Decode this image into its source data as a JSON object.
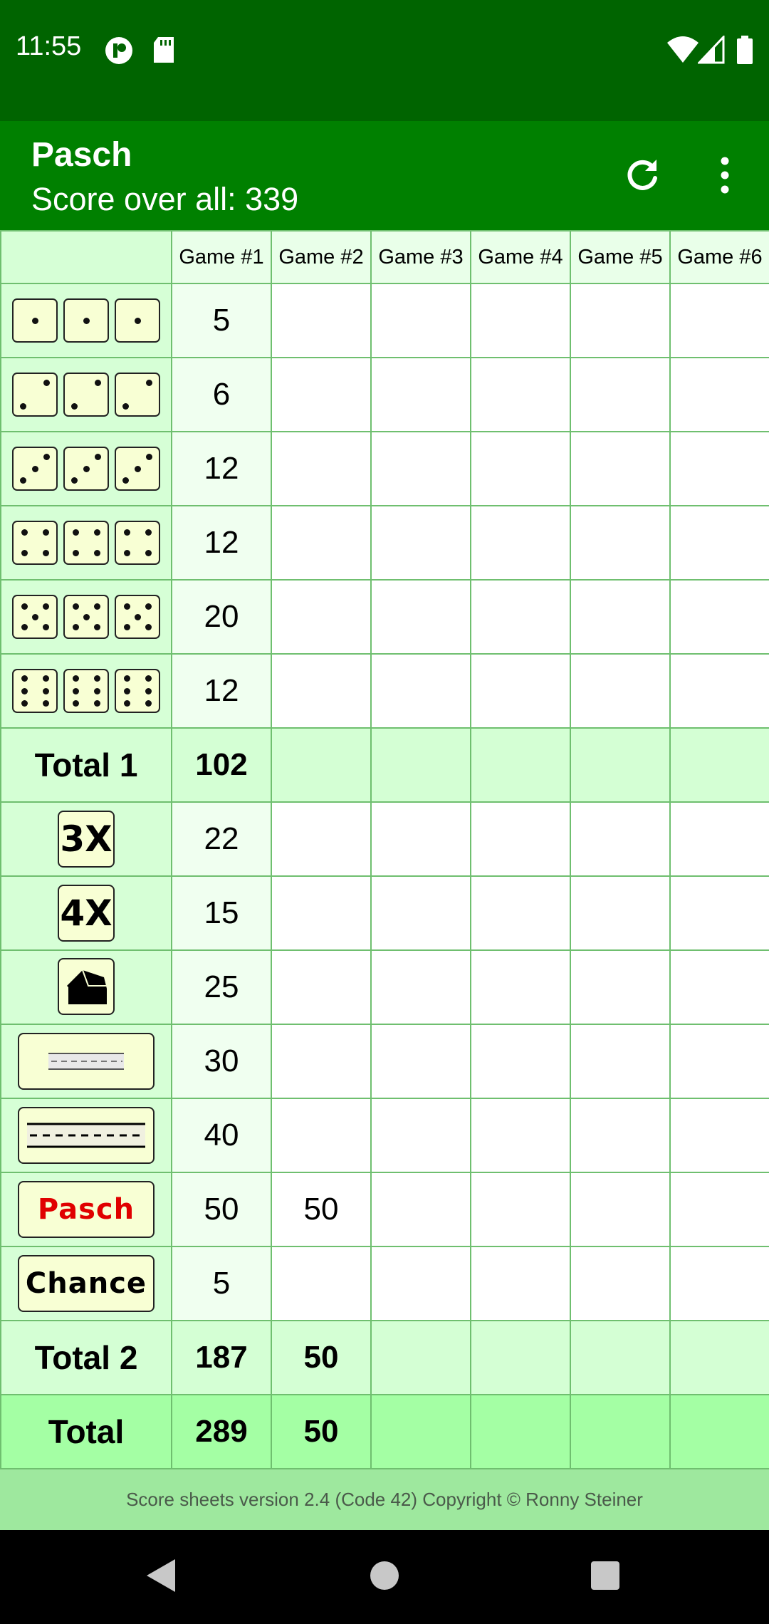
{
  "status_bar": {
    "time": "11:55"
  },
  "app_bar": {
    "title": "Pasch",
    "subtitle": "Score over all: 339",
    "icons": [
      "refresh-icon",
      "more-vert-icon"
    ]
  },
  "table": {
    "headers": [
      "Game #1",
      "Game #2",
      "Game #3",
      "Game #4",
      "Game #5",
      "Game #6"
    ],
    "rows": [
      {
        "label": "ones",
        "cells": [
          "5",
          "",
          "",
          "",
          "",
          ""
        ]
      },
      {
        "label": "twos",
        "cells": [
          "6",
          "",
          "",
          "",
          "",
          ""
        ]
      },
      {
        "label": "threes",
        "cells": [
          "12",
          "",
          "",
          "",
          "",
          ""
        ]
      },
      {
        "label": "fours",
        "cells": [
          "12",
          "",
          "",
          "",
          "",
          ""
        ]
      },
      {
        "label": "fives",
        "cells": [
          "20",
          "",
          "",
          "",
          "",
          ""
        ]
      },
      {
        "label": "sixes",
        "cells": [
          "12",
          "",
          "",
          "",
          "",
          ""
        ]
      },
      {
        "label": "Total 1",
        "cells": [
          "102",
          "",
          "",
          "",
          "",
          ""
        ]
      },
      {
        "label": "3X",
        "cells": [
          "22",
          "",
          "",
          "",
          "",
          ""
        ]
      },
      {
        "label": "4X",
        "cells": [
          "15",
          "",
          "",
          "",
          "",
          ""
        ]
      },
      {
        "label": "full-house",
        "cells": [
          "25",
          "",
          "",
          "",
          "",
          ""
        ]
      },
      {
        "label": "small-straight",
        "cells": [
          "30",
          "",
          "",
          "",
          "",
          ""
        ]
      },
      {
        "label": "large-straight",
        "cells": [
          "40",
          "",
          "",
          "",
          "",
          ""
        ]
      },
      {
        "label": "Pasch",
        "cells": [
          "50",
          "50",
          "",
          "",
          "",
          ""
        ]
      },
      {
        "label": "Chance",
        "cells": [
          "5",
          "",
          "",
          "",
          "",
          ""
        ]
      },
      {
        "label": "Total 2",
        "cells": [
          "187",
          "50",
          "",
          "",
          "",
          ""
        ]
      },
      {
        "label": "Total",
        "cells": [
          "289",
          "50",
          "",
          "",
          "",
          ""
        ]
      }
    ]
  },
  "footer": {
    "text": "Score sheets version 2.4 (Code 42) Copyright © Ronny Steiner"
  },
  "colors": {
    "status_bar": "#006400",
    "app_bar": "#008000",
    "pasch_red": "#e00000"
  }
}
